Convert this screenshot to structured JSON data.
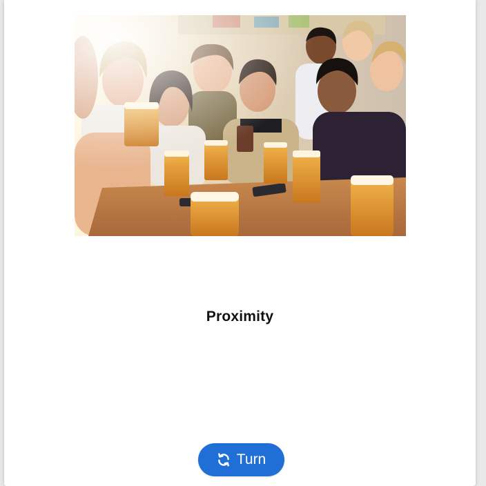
{
  "card": {
    "title": "Proximity",
    "image": {
      "description_icon": "photo-friends-with-beer"
    },
    "turn_button": {
      "label": "Turn",
      "icon": "refresh-icon"
    }
  },
  "colors": {
    "button": "#1f6fd6",
    "title": "#111111",
    "card_background": "#ffffff",
    "page_background": "#e9e9e9"
  }
}
